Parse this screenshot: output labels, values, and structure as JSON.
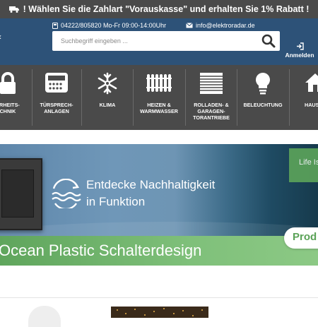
{
  "topbar": {
    "message": "! Wählen Sie die Zahlart \"Vorauskasse\" und erhalten Sie 1% Rabatt !"
  },
  "header": {
    "phone": "04222/805820 Mo-Fr 09:00-14:00Uhr",
    "email": "info@elektroradar.de",
    "search_placeholder": "Suchbegriff eingeben ...",
    "login_label": "Anmelden"
  },
  "categories": [
    {
      "line1": "ERHEITS-",
      "line2": "CHNIK",
      "line3": "",
      "icon": "lock-icon"
    },
    {
      "line1": "TÜRSPRECH-",
      "line2": "ANLAGEN",
      "line3": "",
      "icon": "intercom-icon"
    },
    {
      "line1": "KLIMA",
      "line2": "",
      "line3": "",
      "icon": "snowflake-icon"
    },
    {
      "line1": "HEIZEN &",
      "line2": "WARMWASSER",
      "line3": "",
      "icon": "radiator-icon"
    },
    {
      "line1": "ROLLADEN- &",
      "line2": "GARAGEN-",
      "line3": "TORANTRIEBE",
      "icon": "shutter-icon"
    },
    {
      "line1": "BELEUCHTUNG",
      "line2": "",
      "line3": "",
      "icon": "bulb-icon"
    },
    {
      "line1": "HAUSH",
      "line2": "",
      "line3": "",
      "icon": "house-icon"
    }
  ],
  "banner": {
    "headline1": "Entdecke Nachhaltigkeit",
    "headline2": "in Funktion",
    "greenbar_text": "Ocean Plastic Schalterdesign",
    "life_text": "Life Is",
    "button_text": "Prod"
  }
}
